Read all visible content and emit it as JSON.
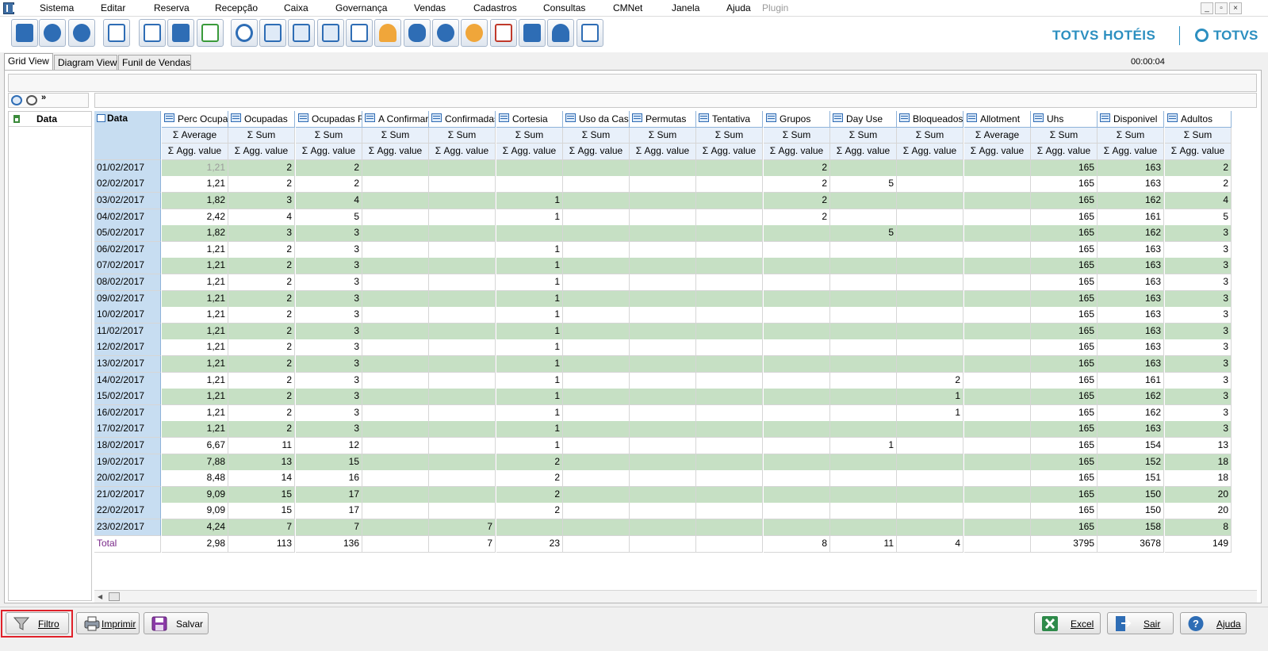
{
  "menu": {
    "items": [
      "Sistema",
      "Editar",
      "Reserva",
      "Recepção",
      "Caixa",
      "Governança",
      "Vendas",
      "Cadastros",
      "Consultas",
      "CMNet",
      "Janela",
      "Ajuda"
    ],
    "plugin": "Plugin"
  },
  "window_controls": {
    "minimize": "_",
    "restore": "▫",
    "close": "×"
  },
  "toolbar": {
    "icons": [
      "exit-icon",
      "user-key-icon",
      "help-icon",
      "org-chart-icon",
      "mail-icon",
      "calculator-icon",
      "mail-send-icon",
      "search-icon",
      "calendar-icon",
      "guest-card-icon",
      "guest-list-icon",
      "report-icon",
      "bell-icon",
      "footsteps-icon",
      "add-user-icon",
      "bellboy-icon",
      "cash-register-icon",
      "pos-icon",
      "maid-icon",
      "address-book-icon"
    ]
  },
  "brand": {
    "primary": "TOTVS HOTÉIS",
    "secondary": "TOTVS"
  },
  "tabs": [
    "Grid View",
    "Diagram View",
    "Funil de Vendas"
  ],
  "timer": "00:00:04",
  "pivot": {
    "row_field": "Data",
    "corner_label": "Data",
    "columns": [
      {
        "name": "Perc Ocupac",
        "agg": "Average",
        "value_label": "Agg. value"
      },
      {
        "name": "Ocupadas",
        "agg": "Sum",
        "value_label": "Agg. value"
      },
      {
        "name": "Ocupadas Re",
        "agg": "Sum",
        "value_label": "Agg. value"
      },
      {
        "name": "A Confirmar",
        "agg": "Sum",
        "value_label": "Agg. value"
      },
      {
        "name": "Confirmadas",
        "agg": "Sum",
        "value_label": "Agg. value"
      },
      {
        "name": "Cortesia",
        "agg": "Sum",
        "value_label": "Agg. value"
      },
      {
        "name": "Uso da Casa",
        "agg": "Sum",
        "value_label": "Agg. value"
      },
      {
        "name": "Permutas",
        "agg": "Sum",
        "value_label": "Agg. value"
      },
      {
        "name": "Tentativa",
        "agg": "Sum",
        "value_label": "Agg. value"
      },
      {
        "name": "Grupos",
        "agg": "Sum",
        "value_label": "Agg. value"
      },
      {
        "name": "Day Use",
        "agg": "Sum",
        "value_label": "Agg. value"
      },
      {
        "name": "Bloqueados",
        "agg": "Sum",
        "value_label": "Agg. value"
      },
      {
        "name": "Allotment",
        "agg": "Average",
        "value_label": "Agg. value"
      },
      {
        "name": "Uhs",
        "agg": "Sum",
        "value_label": "Agg. value"
      },
      {
        "name": "Disponivel",
        "agg": "Sum",
        "value_label": "Agg. value"
      },
      {
        "name": "Adultos",
        "agg": "Sum",
        "value_label": "Agg. value"
      }
    ],
    "rows": [
      {
        "date": "01/02/2017",
        "values": [
          "1,21",
          "2",
          "2",
          "",
          "",
          "",
          "",
          "",
          "",
          "2",
          "",
          "",
          "",
          "165",
          "163",
          "2"
        ]
      },
      {
        "date": "02/02/2017",
        "values": [
          "1,21",
          "2",
          "2",
          "",
          "",
          "",
          "",
          "",
          "",
          "2",
          "5",
          "",
          "",
          "165",
          "163",
          "2"
        ]
      },
      {
        "date": "03/02/2017",
        "values": [
          "1,82",
          "3",
          "4",
          "",
          "",
          "1",
          "",
          "",
          "",
          "2",
          "",
          "",
          "",
          "165",
          "162",
          "4"
        ]
      },
      {
        "date": "04/02/2017",
        "values": [
          "2,42",
          "4",
          "5",
          "",
          "",
          "1",
          "",
          "",
          "",
          "2",
          "",
          "",
          "",
          "165",
          "161",
          "5"
        ]
      },
      {
        "date": "05/02/2017",
        "values": [
          "1,82",
          "3",
          "3",
          "",
          "",
          "",
          "",
          "",
          "",
          "",
          "5",
          "",
          "",
          "165",
          "162",
          "3"
        ]
      },
      {
        "date": "06/02/2017",
        "values": [
          "1,21",
          "2",
          "3",
          "",
          "",
          "1",
          "",
          "",
          "",
          "",
          "",
          "",
          "",
          "165",
          "163",
          "3"
        ]
      },
      {
        "date": "07/02/2017",
        "values": [
          "1,21",
          "2",
          "3",
          "",
          "",
          "1",
          "",
          "",
          "",
          "",
          "",
          "",
          "",
          "165",
          "163",
          "3"
        ]
      },
      {
        "date": "08/02/2017",
        "values": [
          "1,21",
          "2",
          "3",
          "",
          "",
          "1",
          "",
          "",
          "",
          "",
          "",
          "",
          "",
          "165",
          "163",
          "3"
        ]
      },
      {
        "date": "09/02/2017",
        "values": [
          "1,21",
          "2",
          "3",
          "",
          "",
          "1",
          "",
          "",
          "",
          "",
          "",
          "",
          "",
          "165",
          "163",
          "3"
        ]
      },
      {
        "date": "10/02/2017",
        "values": [
          "1,21",
          "2",
          "3",
          "",
          "",
          "1",
          "",
          "",
          "",
          "",
          "",
          "",
          "",
          "165",
          "163",
          "3"
        ]
      },
      {
        "date": "11/02/2017",
        "values": [
          "1,21",
          "2",
          "3",
          "",
          "",
          "1",
          "",
          "",
          "",
          "",
          "",
          "",
          "",
          "165",
          "163",
          "3"
        ]
      },
      {
        "date": "12/02/2017",
        "values": [
          "1,21",
          "2",
          "3",
          "",
          "",
          "1",
          "",
          "",
          "",
          "",
          "",
          "",
          "",
          "165",
          "163",
          "3"
        ]
      },
      {
        "date": "13/02/2017",
        "values": [
          "1,21",
          "2",
          "3",
          "",
          "",
          "1",
          "",
          "",
          "",
          "",
          "",
          "",
          "",
          "165",
          "163",
          "3"
        ]
      },
      {
        "date": "14/02/2017",
        "values": [
          "1,21",
          "2",
          "3",
          "",
          "",
          "1",
          "",
          "",
          "",
          "",
          "",
          "2",
          "",
          "165",
          "161",
          "3"
        ]
      },
      {
        "date": "15/02/2017",
        "values": [
          "1,21",
          "2",
          "3",
          "",
          "",
          "1",
          "",
          "",
          "",
          "",
          "",
          "1",
          "",
          "165",
          "162",
          "3"
        ]
      },
      {
        "date": "16/02/2017",
        "values": [
          "1,21",
          "2",
          "3",
          "",
          "",
          "1",
          "",
          "",
          "",
          "",
          "",
          "1",
          "",
          "165",
          "162",
          "3"
        ]
      },
      {
        "date": "17/02/2017",
        "values": [
          "1,21",
          "2",
          "3",
          "",
          "",
          "1",
          "",
          "",
          "",
          "",
          "",
          "",
          "",
          "165",
          "163",
          "3"
        ]
      },
      {
        "date": "18/02/2017",
        "values": [
          "6,67",
          "11",
          "12",
          "",
          "",
          "1",
          "",
          "",
          "",
          "",
          "1",
          "",
          "",
          "165",
          "154",
          "13"
        ]
      },
      {
        "date": "19/02/2017",
        "values": [
          "7,88",
          "13",
          "15",
          "",
          "",
          "2",
          "",
          "",
          "",
          "",
          "",
          "",
          "",
          "165",
          "152",
          "18"
        ]
      },
      {
        "date": "20/02/2017",
        "values": [
          "8,48",
          "14",
          "16",
          "",
          "",
          "2",
          "",
          "",
          "",
          "",
          "",
          "",
          "",
          "165",
          "151",
          "18"
        ]
      },
      {
        "date": "21/02/2017",
        "values": [
          "9,09",
          "15",
          "17",
          "",
          "",
          "2",
          "",
          "",
          "",
          "",
          "",
          "",
          "",
          "165",
          "150",
          "20"
        ]
      },
      {
        "date": "22/02/2017",
        "values": [
          "9,09",
          "15",
          "17",
          "",
          "",
          "2",
          "",
          "",
          "",
          "",
          "",
          "",
          "",
          "165",
          "150",
          "20"
        ]
      },
      {
        "date": "23/02/2017",
        "values": [
          "4,24",
          "7",
          "7",
          "",
          "7",
          "",
          "",
          "",
          "",
          "",
          "",
          "",
          "",
          "165",
          "158",
          "8"
        ]
      }
    ],
    "total": {
      "label": "Total",
      "values": [
        "2,98",
        "113",
        "136",
        "",
        "7",
        "23",
        "",
        "",
        "",
        "8",
        "11",
        "4",
        "",
        "3795",
        "3678",
        "149"
      ]
    }
  },
  "bottom_buttons": {
    "filtro": "Filtro",
    "imprimir": "Imprimir",
    "salvar": "Salvar",
    "excel": "Excel",
    "sair": "Sair",
    "ajuda": "Ajuda"
  },
  "colors": {
    "row_green": "#c6e0c4",
    "header_blue": "#c7ddf1",
    "brand": "#2c8fc0",
    "highlight": "#e0212a"
  }
}
